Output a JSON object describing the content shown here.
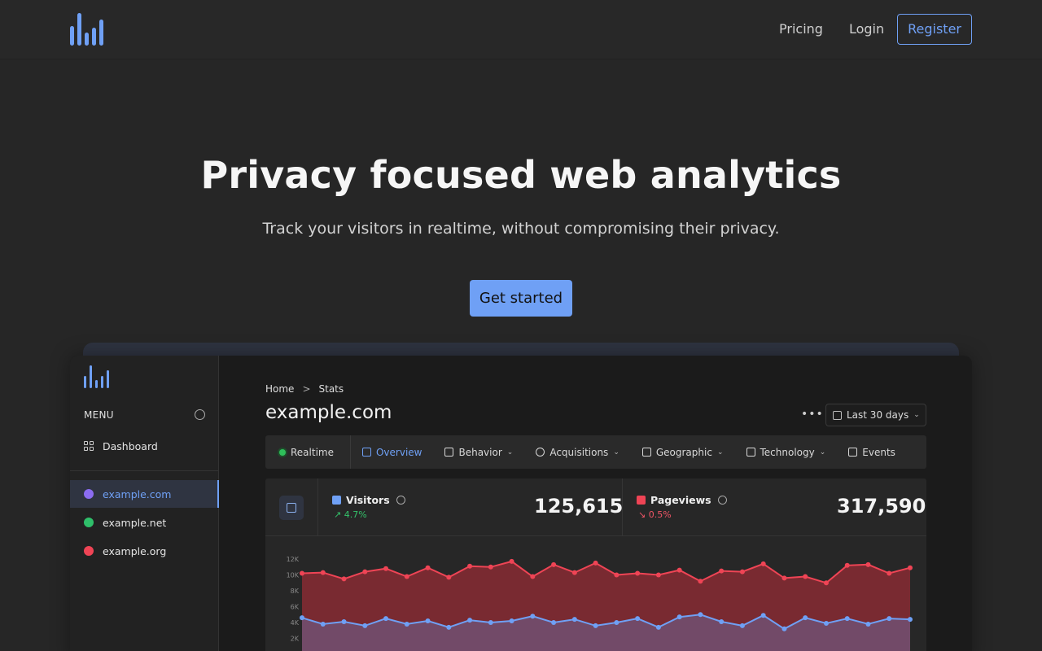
{
  "nav": {
    "pricing": "Pricing",
    "login": "Login",
    "register": "Register"
  },
  "hero": {
    "title": "Privacy focused web analytics",
    "subtitle": "Track your visitors in realtime, without compromising their privacy.",
    "cta": "Get started"
  },
  "colors": {
    "accent": "#6fa0f5",
    "visitors": "#6fa0f5",
    "pageviews": "#ef4455"
  },
  "dashboard": {
    "menu_label": "MENU",
    "nav_dashboard": "Dashboard",
    "sites": [
      {
        "label": "example.com",
        "color": "#8b6cf0"
      },
      {
        "label": "example.net",
        "color": "#2fbf6a"
      },
      {
        "label": "example.org",
        "color": "#ef4455"
      }
    ],
    "breadcrumb": {
      "home": "Home",
      "sep": ">",
      "current": "Stats"
    },
    "site_title": "example.com",
    "more": "•••",
    "date_range": "Last 30 days",
    "tabs": [
      {
        "label": "Realtime"
      },
      {
        "label": "Overview"
      },
      {
        "label": "Behavior"
      },
      {
        "label": "Acquisitions"
      },
      {
        "label": "Geographic"
      },
      {
        "label": "Technology"
      },
      {
        "label": "Events"
      }
    ],
    "visitors": {
      "label": "Visitors",
      "delta": "4.7%",
      "value": "125,615"
    },
    "pageviews": {
      "label": "Pageviews",
      "delta": "0.5%",
      "value": "317,590"
    }
  },
  "chart_data": {
    "type": "area",
    "title": "",
    "xlabel": "",
    "ylabel": "",
    "y_ticks": [
      "12K",
      "10K",
      "8K",
      "6K",
      "4K",
      "2K"
    ],
    "ylim": [
      0,
      12000
    ],
    "series": [
      {
        "name": "Pageviews",
        "color": "#ef4455",
        "values": [
          10200,
          10300,
          9500,
          10400,
          10800,
          9800,
          10900,
          9700,
          11100,
          11000,
          11700,
          9800,
          11300,
          10300,
          11500,
          10000,
          10200,
          10000,
          10600,
          9200,
          10500,
          10400,
          11400,
          9600,
          9800,
          9000,
          11200,
          11300,
          10200,
          10900
        ]
      },
      {
        "name": "Visitors",
        "color": "#6fa0f5",
        "values": [
          4600,
          3800,
          4100,
          3600,
          4500,
          3800,
          4200,
          3400,
          4300,
          4000,
          4200,
          4800,
          4000,
          4400,
          3600,
          4000,
          4500,
          3400,
          4700,
          5000,
          4100,
          3600,
          4900,
          3200,
          4600,
          3900,
          4500,
          3800,
          4500,
          4400
        ]
      }
    ]
  }
}
